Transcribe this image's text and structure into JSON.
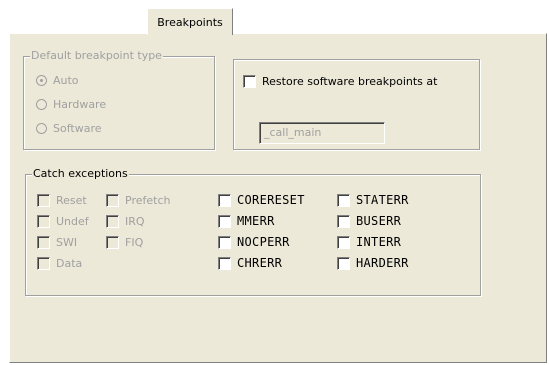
{
  "tab": {
    "label": "Breakpoints"
  },
  "default_type": {
    "legend": "Default breakpoint type",
    "options": [
      {
        "label": "Auto",
        "checked": true
      },
      {
        "label": "Hardware",
        "checked": false
      },
      {
        "label": "Software",
        "checked": false
      }
    ]
  },
  "restore": {
    "label": "Restore software breakpoints at",
    "field_value": "_call_main"
  },
  "catch": {
    "legend": "Catch exceptions",
    "basic": [
      "Reset",
      "Prefetch",
      "Undef",
      "IRQ",
      "SWI",
      "FIQ",
      "Data"
    ],
    "advanced": [
      "CORERESET",
      "STATERR",
      "MMERR",
      "BUSERR",
      "NOCPERR",
      "INTERR",
      "CHRERR",
      "HARDERR"
    ]
  }
}
